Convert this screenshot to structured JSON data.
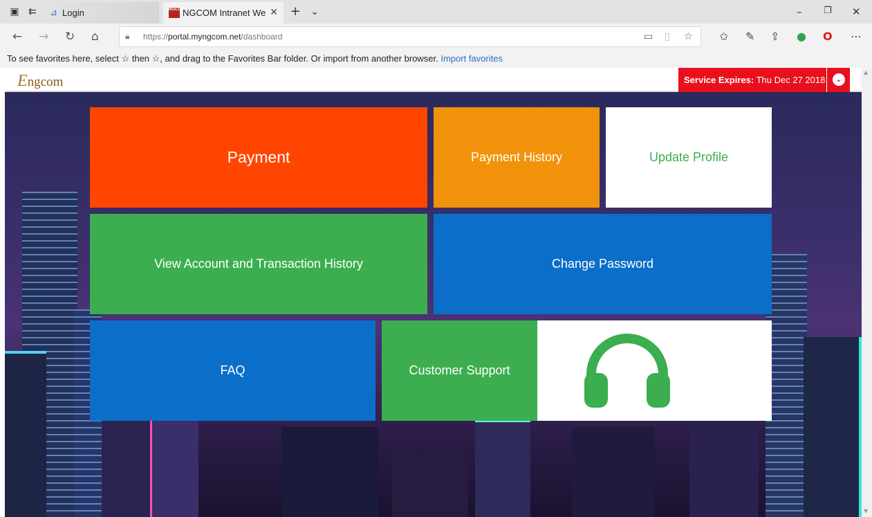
{
  "browser": {
    "tabs": [
      {
        "label": "Login"
      },
      {
        "label": "NGCOM Intranet Web F"
      }
    ],
    "favicon_text": "NGCOM",
    "url_prefix": "https://",
    "url_host": "portal.myngcom.net",
    "url_path": "/dashboard",
    "favorites_message": "To see favorites here, select ☆ then ☆, and drag to the Favorites Bar folder. Or import from another browser.",
    "import_link": "Import favorites"
  },
  "header": {
    "logo_initial": "E",
    "logo_rest": "ngcom",
    "expiry_label": "Service Expires:",
    "expiry_date": "Thu Dec 27 2018"
  },
  "tiles": {
    "payment": "Payment",
    "payment_history": "Payment History",
    "update_profile": "Update Profile",
    "account_history": "View Account and Transaction History",
    "change_password": "Change Password",
    "faq": "FAQ",
    "customer_support": "Customer Support"
  },
  "icons": {
    "support": "headphones-icon"
  },
  "colors": {
    "payment": "#ff4500",
    "payment_history": "#f2920a",
    "green": "#3cae4f",
    "blue": "#0b6fc9",
    "expiry": "#e8101d"
  }
}
